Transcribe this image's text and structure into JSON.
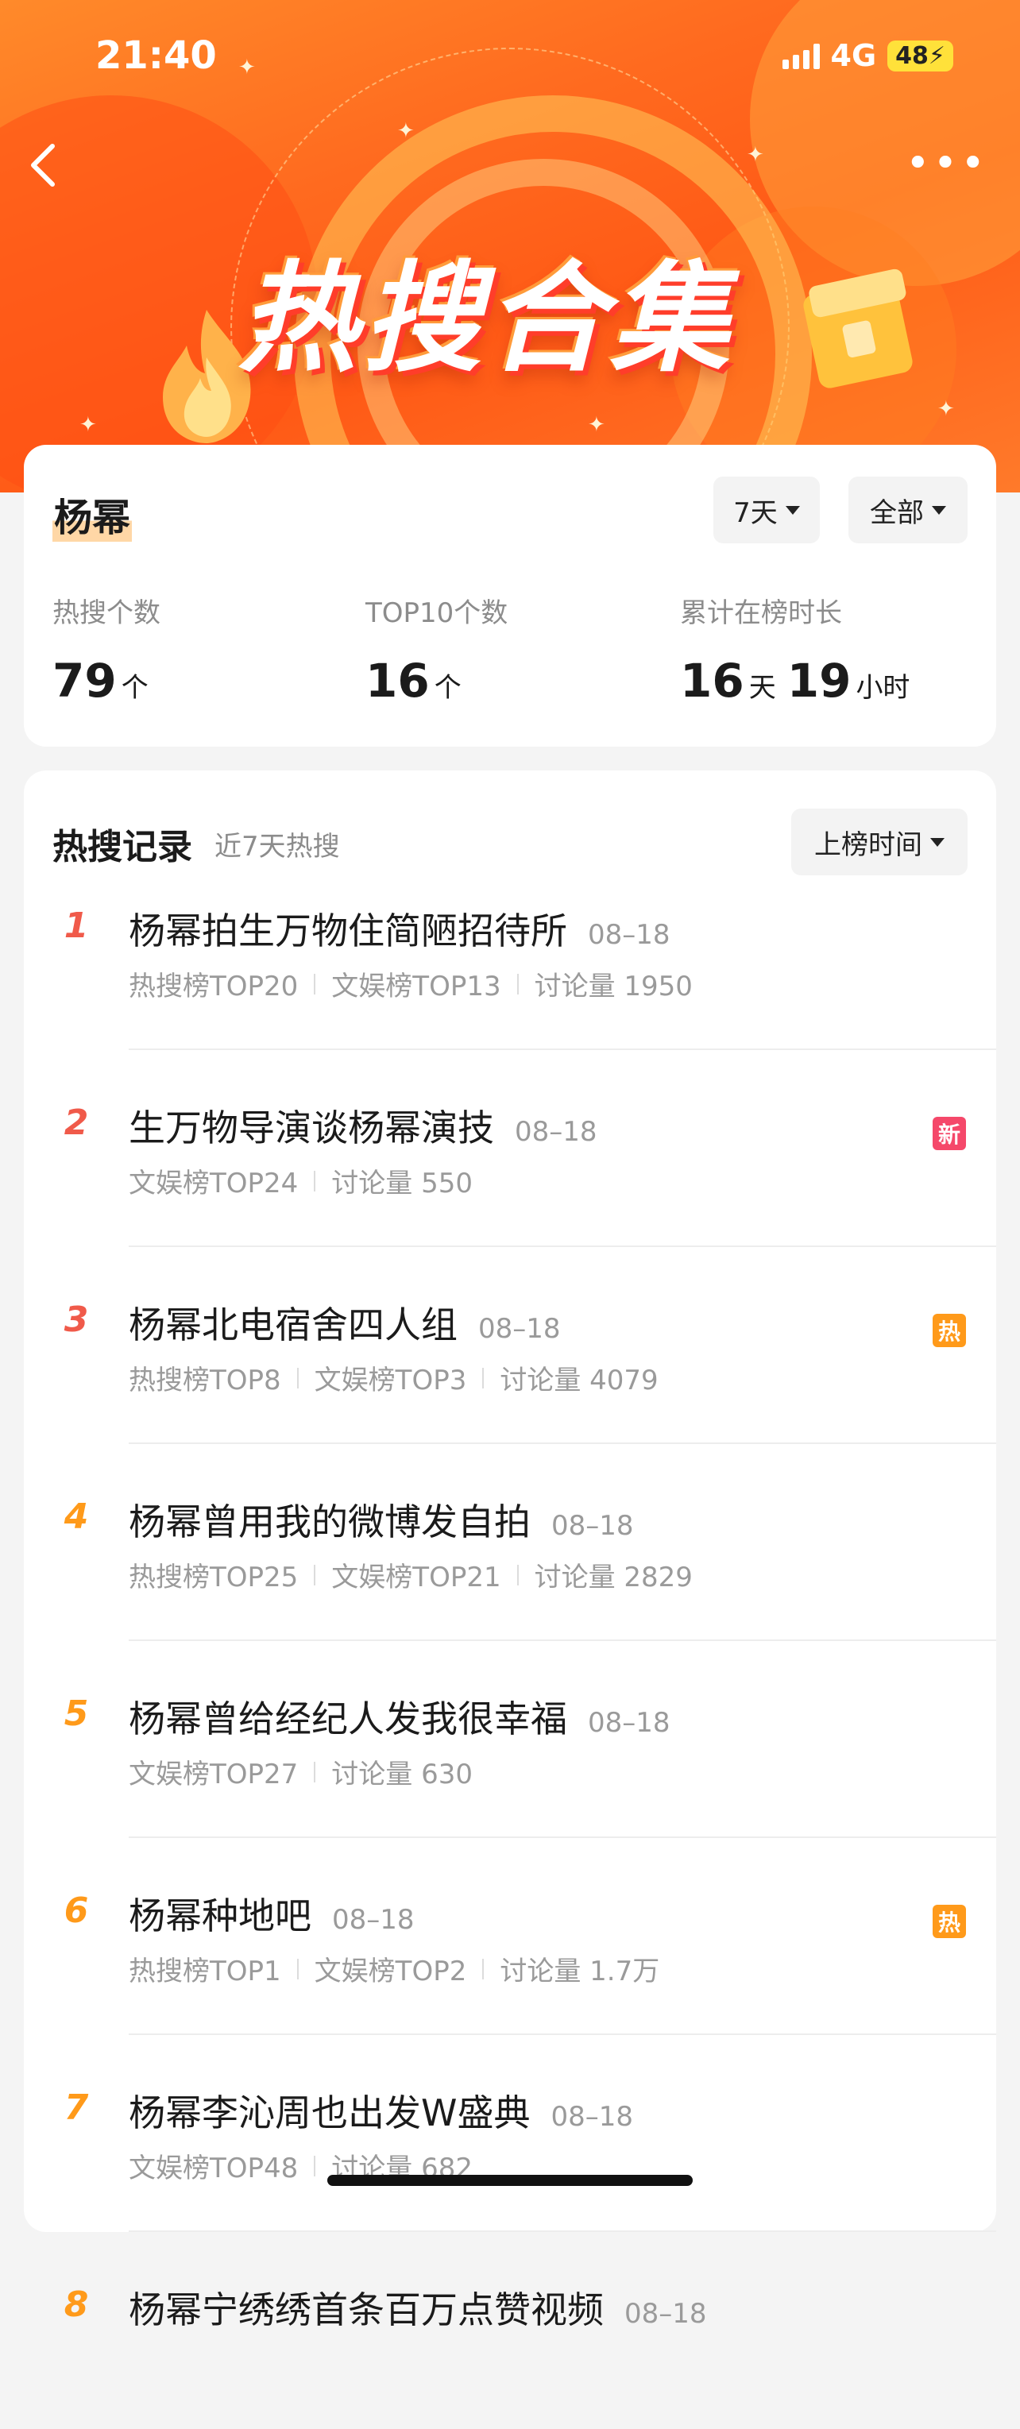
{
  "status_bar": {
    "time": "21:40",
    "network": "4G",
    "battery": "48"
  },
  "banner": {
    "title": "热搜合集"
  },
  "summary": {
    "name": "杨幂",
    "filter_days": "7天",
    "filter_scope": "全部",
    "stats": [
      {
        "label": "热搜个数",
        "value": "79",
        "unit": "个"
      },
      {
        "label": "TOP10个数",
        "value": "16",
        "unit": "个"
      },
      {
        "label": "累计在榜时长",
        "value": "16",
        "unit": "天",
        "value2": "19",
        "unit2": "小时"
      }
    ]
  },
  "records": {
    "title": "热搜记录",
    "subtitle": "近7天热搜",
    "sort_label": "上榜时间",
    "items": [
      {
        "rank": "1",
        "rank_color": "#f05a4a",
        "title": "杨幂拍生万物住简陋招待所",
        "date": "08–18",
        "meta": [
          "热搜榜TOP20",
          "文娱榜TOP13",
          "讨论量 1950"
        ],
        "badge": ""
      },
      {
        "rank": "2",
        "rank_color": "#f05a4a",
        "title": "生万物导演谈杨幂演技",
        "date": "08–18",
        "meta": [
          "文娱榜TOP24",
          "讨论量 550"
        ],
        "badge": "新",
        "badge_color": "#f5486a"
      },
      {
        "rank": "3",
        "rank_color": "#f05a4a",
        "title": "杨幂北电宿舍四人组",
        "date": "08–18",
        "meta": [
          "热搜榜TOP8",
          "文娱榜TOP3",
          "讨论量 4079"
        ],
        "badge": "热",
        "badge_color": "#ff9a1a"
      },
      {
        "rank": "4",
        "rank_color": "#ff9a1a",
        "title": "杨幂曾用我的微博发自拍",
        "date": "08–18",
        "meta": [
          "热搜榜TOP25",
          "文娱榜TOP21",
          "讨论量 2829"
        ],
        "badge": ""
      },
      {
        "rank": "5",
        "rank_color": "#ff9a1a",
        "title": "杨幂曾给经纪人发我很幸福",
        "date": "08–18",
        "meta": [
          "文娱榜TOP27",
          "讨论量 630"
        ],
        "badge": ""
      },
      {
        "rank": "6",
        "rank_color": "#ff9a1a",
        "title": "杨幂种地吧",
        "date": "08–18",
        "meta": [
          "热搜榜TOP1",
          "文娱榜TOP2",
          "讨论量 1.7万"
        ],
        "badge": "热",
        "badge_color": "#ff9a1a"
      },
      {
        "rank": "7",
        "rank_color": "#ff9a1a",
        "title": "杨幂李沁周也出发W盛典",
        "date": "08–18",
        "meta": [
          "文娱榜TOP48",
          "讨论量 682"
        ],
        "badge": ""
      },
      {
        "rank": "8",
        "rank_color": "#ff9a1a",
        "title": "杨幂宁绣绣首条百万点赞视频",
        "date": "08–18",
        "meta": [],
        "badge": ""
      }
    ]
  }
}
